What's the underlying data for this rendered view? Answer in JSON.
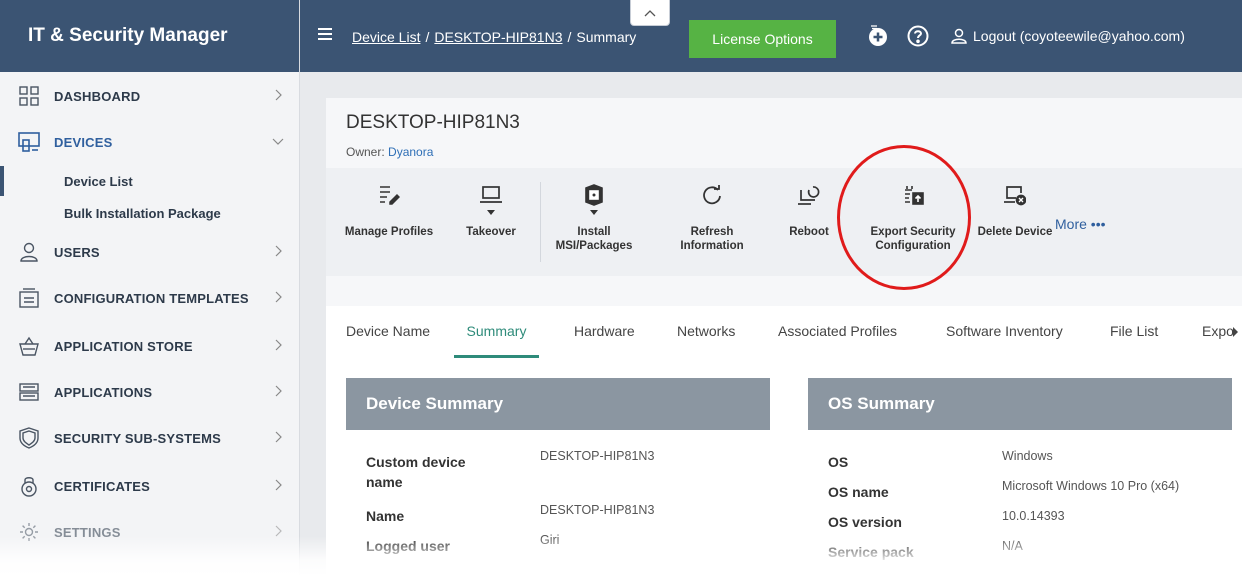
{
  "app": {
    "title": "IT & Security Manager"
  },
  "sidebar": {
    "items": [
      {
        "label": "DASHBOARD",
        "icon": "dashboard-grid-icon"
      },
      {
        "label": "DEVICES",
        "icon": "devices-icon",
        "expanded": true
      },
      {
        "label": "USERS",
        "icon": "user-icon"
      },
      {
        "label": "CONFIGURATION TEMPLATES",
        "icon": "templates-icon"
      },
      {
        "label": "APPLICATION STORE",
        "icon": "store-basket-icon"
      },
      {
        "label": "APPLICATIONS",
        "icon": "applications-icon"
      },
      {
        "label": "SECURITY SUB-SYSTEMS",
        "icon": "shield-icon"
      },
      {
        "label": "CERTIFICATES",
        "icon": "certificate-icon"
      },
      {
        "label": "SETTINGS",
        "icon": "gear-icon"
      }
    ],
    "subitems": [
      {
        "label": "Device List",
        "active": true
      },
      {
        "label": "Bulk Installation Package"
      }
    ]
  },
  "topbar": {
    "breadcrumb": [
      "Device List",
      "DESKTOP-HIP81N3",
      "Summary"
    ],
    "license_label": "License Options",
    "logout_label": "Logout (coyoteewile@yahoo.com)"
  },
  "device": {
    "title": "DESKTOP-HIP81N3",
    "owner_label": "Owner:",
    "owner_value": "Dyanora"
  },
  "toolbar": {
    "actions": [
      {
        "label": "Manage Profiles",
        "icon": "manage-profiles-icon"
      },
      {
        "label": "Takeover",
        "icon": "laptop-icon"
      },
      {
        "label": "Install\nMSI/Packages",
        "icon": "package-icon"
      },
      {
        "label": "Refresh\nInformation",
        "icon": "refresh-icon"
      },
      {
        "label": "Reboot",
        "icon": "reboot-icon"
      },
      {
        "label": "Export Security\nConfiguration",
        "icon": "export-config-icon"
      },
      {
        "label": "Delete Device",
        "icon": "delete-device-icon"
      }
    ],
    "more_label": "More •••"
  },
  "tabs": [
    {
      "label": "Device Name"
    },
    {
      "label": "Summary",
      "active": true
    },
    {
      "label": "Hardware"
    },
    {
      "label": "Networks"
    },
    {
      "label": "Associated Profiles"
    },
    {
      "label": "Software Inventory"
    },
    {
      "label": "File List"
    },
    {
      "label": "Expo"
    }
  ],
  "device_summary": {
    "title": "Device Summary",
    "rows": [
      {
        "key": "Custom device\nname",
        "value": "DESKTOP-HIP81N3"
      },
      {
        "key": "Name",
        "value": "DESKTOP-HIP81N3"
      },
      {
        "key": "Logged user",
        "value": "Giri"
      }
    ]
  },
  "os_summary": {
    "title": "OS Summary",
    "rows": [
      {
        "key": "OS",
        "value": "Windows"
      },
      {
        "key": "OS name",
        "value": "Microsoft Windows 10 Pro (x64)"
      },
      {
        "key": "OS version",
        "value": "10.0.14393"
      },
      {
        "key": "Service pack",
        "value": "N/A"
      }
    ]
  },
  "colors": {
    "brand": "#3b5473",
    "accent_green": "#56b344",
    "active_tab": "#2e8b7a",
    "highlight_circle": "#e01b1b"
  }
}
